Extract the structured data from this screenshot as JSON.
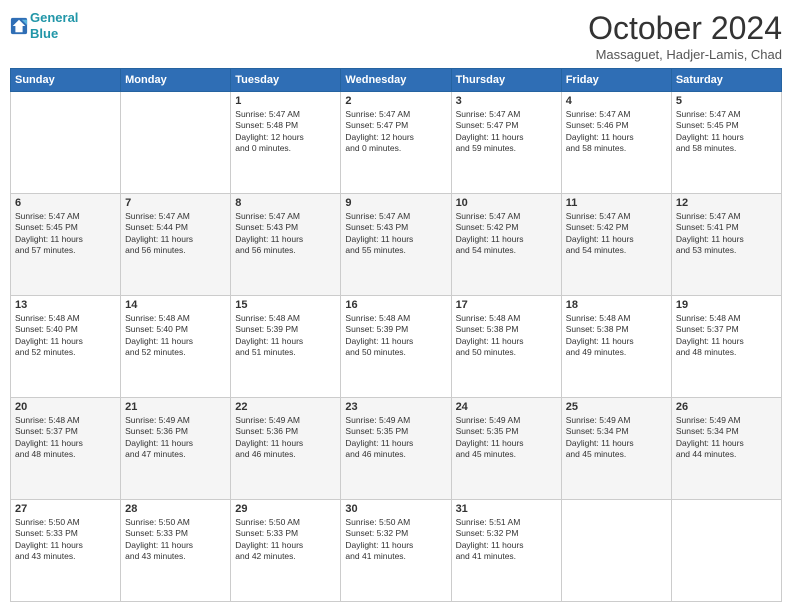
{
  "header": {
    "logo_line1": "General",
    "logo_line2": "Blue",
    "month": "October 2024",
    "location": "Massaguet, Hadjer-Lamis, Chad"
  },
  "weekdays": [
    "Sunday",
    "Monday",
    "Tuesday",
    "Wednesday",
    "Thursday",
    "Friday",
    "Saturday"
  ],
  "rows": [
    [
      {
        "day": "",
        "lines": []
      },
      {
        "day": "",
        "lines": []
      },
      {
        "day": "1",
        "lines": [
          "Sunrise: 5:47 AM",
          "Sunset: 5:48 PM",
          "Daylight: 12 hours",
          "and 0 minutes."
        ]
      },
      {
        "day": "2",
        "lines": [
          "Sunrise: 5:47 AM",
          "Sunset: 5:47 PM",
          "Daylight: 12 hours",
          "and 0 minutes."
        ]
      },
      {
        "day": "3",
        "lines": [
          "Sunrise: 5:47 AM",
          "Sunset: 5:47 PM",
          "Daylight: 11 hours",
          "and 59 minutes."
        ]
      },
      {
        "day": "4",
        "lines": [
          "Sunrise: 5:47 AM",
          "Sunset: 5:46 PM",
          "Daylight: 11 hours",
          "and 58 minutes."
        ]
      },
      {
        "day": "5",
        "lines": [
          "Sunrise: 5:47 AM",
          "Sunset: 5:45 PM",
          "Daylight: 11 hours",
          "and 58 minutes."
        ]
      }
    ],
    [
      {
        "day": "6",
        "lines": [
          "Sunrise: 5:47 AM",
          "Sunset: 5:45 PM",
          "Daylight: 11 hours",
          "and 57 minutes."
        ]
      },
      {
        "day": "7",
        "lines": [
          "Sunrise: 5:47 AM",
          "Sunset: 5:44 PM",
          "Daylight: 11 hours",
          "and 56 minutes."
        ]
      },
      {
        "day": "8",
        "lines": [
          "Sunrise: 5:47 AM",
          "Sunset: 5:43 PM",
          "Daylight: 11 hours",
          "and 56 minutes."
        ]
      },
      {
        "day": "9",
        "lines": [
          "Sunrise: 5:47 AM",
          "Sunset: 5:43 PM",
          "Daylight: 11 hours",
          "and 55 minutes."
        ]
      },
      {
        "day": "10",
        "lines": [
          "Sunrise: 5:47 AM",
          "Sunset: 5:42 PM",
          "Daylight: 11 hours",
          "and 54 minutes."
        ]
      },
      {
        "day": "11",
        "lines": [
          "Sunrise: 5:47 AM",
          "Sunset: 5:42 PM",
          "Daylight: 11 hours",
          "and 54 minutes."
        ]
      },
      {
        "day": "12",
        "lines": [
          "Sunrise: 5:47 AM",
          "Sunset: 5:41 PM",
          "Daylight: 11 hours",
          "and 53 minutes."
        ]
      }
    ],
    [
      {
        "day": "13",
        "lines": [
          "Sunrise: 5:48 AM",
          "Sunset: 5:40 PM",
          "Daylight: 11 hours",
          "and 52 minutes."
        ]
      },
      {
        "day": "14",
        "lines": [
          "Sunrise: 5:48 AM",
          "Sunset: 5:40 PM",
          "Daylight: 11 hours",
          "and 52 minutes."
        ]
      },
      {
        "day": "15",
        "lines": [
          "Sunrise: 5:48 AM",
          "Sunset: 5:39 PM",
          "Daylight: 11 hours",
          "and 51 minutes."
        ]
      },
      {
        "day": "16",
        "lines": [
          "Sunrise: 5:48 AM",
          "Sunset: 5:39 PM",
          "Daylight: 11 hours",
          "and 50 minutes."
        ]
      },
      {
        "day": "17",
        "lines": [
          "Sunrise: 5:48 AM",
          "Sunset: 5:38 PM",
          "Daylight: 11 hours",
          "and 50 minutes."
        ]
      },
      {
        "day": "18",
        "lines": [
          "Sunrise: 5:48 AM",
          "Sunset: 5:38 PM",
          "Daylight: 11 hours",
          "and 49 minutes."
        ]
      },
      {
        "day": "19",
        "lines": [
          "Sunrise: 5:48 AM",
          "Sunset: 5:37 PM",
          "Daylight: 11 hours",
          "and 48 minutes."
        ]
      }
    ],
    [
      {
        "day": "20",
        "lines": [
          "Sunrise: 5:48 AM",
          "Sunset: 5:37 PM",
          "Daylight: 11 hours",
          "and 48 minutes."
        ]
      },
      {
        "day": "21",
        "lines": [
          "Sunrise: 5:49 AM",
          "Sunset: 5:36 PM",
          "Daylight: 11 hours",
          "and 47 minutes."
        ]
      },
      {
        "day": "22",
        "lines": [
          "Sunrise: 5:49 AM",
          "Sunset: 5:36 PM",
          "Daylight: 11 hours",
          "and 46 minutes."
        ]
      },
      {
        "day": "23",
        "lines": [
          "Sunrise: 5:49 AM",
          "Sunset: 5:35 PM",
          "Daylight: 11 hours",
          "and 46 minutes."
        ]
      },
      {
        "day": "24",
        "lines": [
          "Sunrise: 5:49 AM",
          "Sunset: 5:35 PM",
          "Daylight: 11 hours",
          "and 45 minutes."
        ]
      },
      {
        "day": "25",
        "lines": [
          "Sunrise: 5:49 AM",
          "Sunset: 5:34 PM",
          "Daylight: 11 hours",
          "and 45 minutes."
        ]
      },
      {
        "day": "26",
        "lines": [
          "Sunrise: 5:49 AM",
          "Sunset: 5:34 PM",
          "Daylight: 11 hours",
          "and 44 minutes."
        ]
      }
    ],
    [
      {
        "day": "27",
        "lines": [
          "Sunrise: 5:50 AM",
          "Sunset: 5:33 PM",
          "Daylight: 11 hours",
          "and 43 minutes."
        ]
      },
      {
        "day": "28",
        "lines": [
          "Sunrise: 5:50 AM",
          "Sunset: 5:33 PM",
          "Daylight: 11 hours",
          "and 43 minutes."
        ]
      },
      {
        "day": "29",
        "lines": [
          "Sunrise: 5:50 AM",
          "Sunset: 5:33 PM",
          "Daylight: 11 hours",
          "and 42 minutes."
        ]
      },
      {
        "day": "30",
        "lines": [
          "Sunrise: 5:50 AM",
          "Sunset: 5:32 PM",
          "Daylight: 11 hours",
          "and 41 minutes."
        ]
      },
      {
        "day": "31",
        "lines": [
          "Sunrise: 5:51 AM",
          "Sunset: 5:32 PM",
          "Daylight: 11 hours",
          "and 41 minutes."
        ]
      },
      {
        "day": "",
        "lines": []
      },
      {
        "day": "",
        "lines": []
      }
    ]
  ]
}
